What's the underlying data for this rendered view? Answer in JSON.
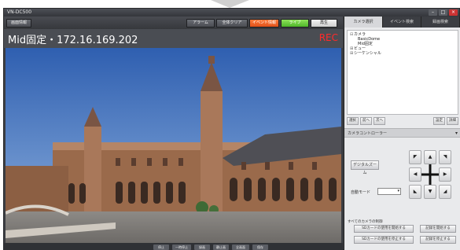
{
  "window": {
    "title": "VN-DC500"
  },
  "toolbar": {
    "left_button": "画面情報",
    "buttons": [
      "アラーム",
      "全体クリア",
      "イベント情報",
      "ライブ",
      "再生"
    ]
  },
  "camera_view": {
    "name": "Mid固定・172.16.169.202",
    "rec_label": "REC"
  },
  "bottom_bar": {
    "buttons": [
      "停止",
      "一時停止",
      "録画",
      "静止画",
      "全画面",
      "保存"
    ]
  },
  "right_panel": {
    "tabs": [
      "カメラ選択",
      "イベント検索",
      "録画検索"
    ],
    "tree": [
      {
        "label": "カメラ",
        "toggle": "⊟",
        "indent": 0
      },
      {
        "label": "BasicDome",
        "toggle": "",
        "indent": 2
      },
      {
        "label": "Mid固定",
        "toggle": "",
        "indent": 2
      },
      {
        "label": "ビュー",
        "toggle": "⊞",
        "indent": 0
      },
      {
        "label": "シーケンシャル",
        "toggle": "⊞",
        "indent": 0
      }
    ],
    "tree_buttons": [
      "選択",
      "前へ",
      "次へ",
      "設定",
      "詳細"
    ],
    "camera_control": {
      "title": "カメラコントローラー",
      "digital_zoom": "デジタルズーム",
      "auto_mode_label": "自動モード",
      "auto_mode_value": ""
    },
    "all_cameras_label": "すべてのカメラの制御",
    "sd_buttons": [
      "SDカードの使用を開始する",
      "記録を開始する",
      "SDカードの使用を停止する",
      "記録を停止する"
    ]
  },
  "colors": {
    "rec": "#ff2a2a",
    "event_button": "#e0521a",
    "live_button": "#4fb82a"
  }
}
